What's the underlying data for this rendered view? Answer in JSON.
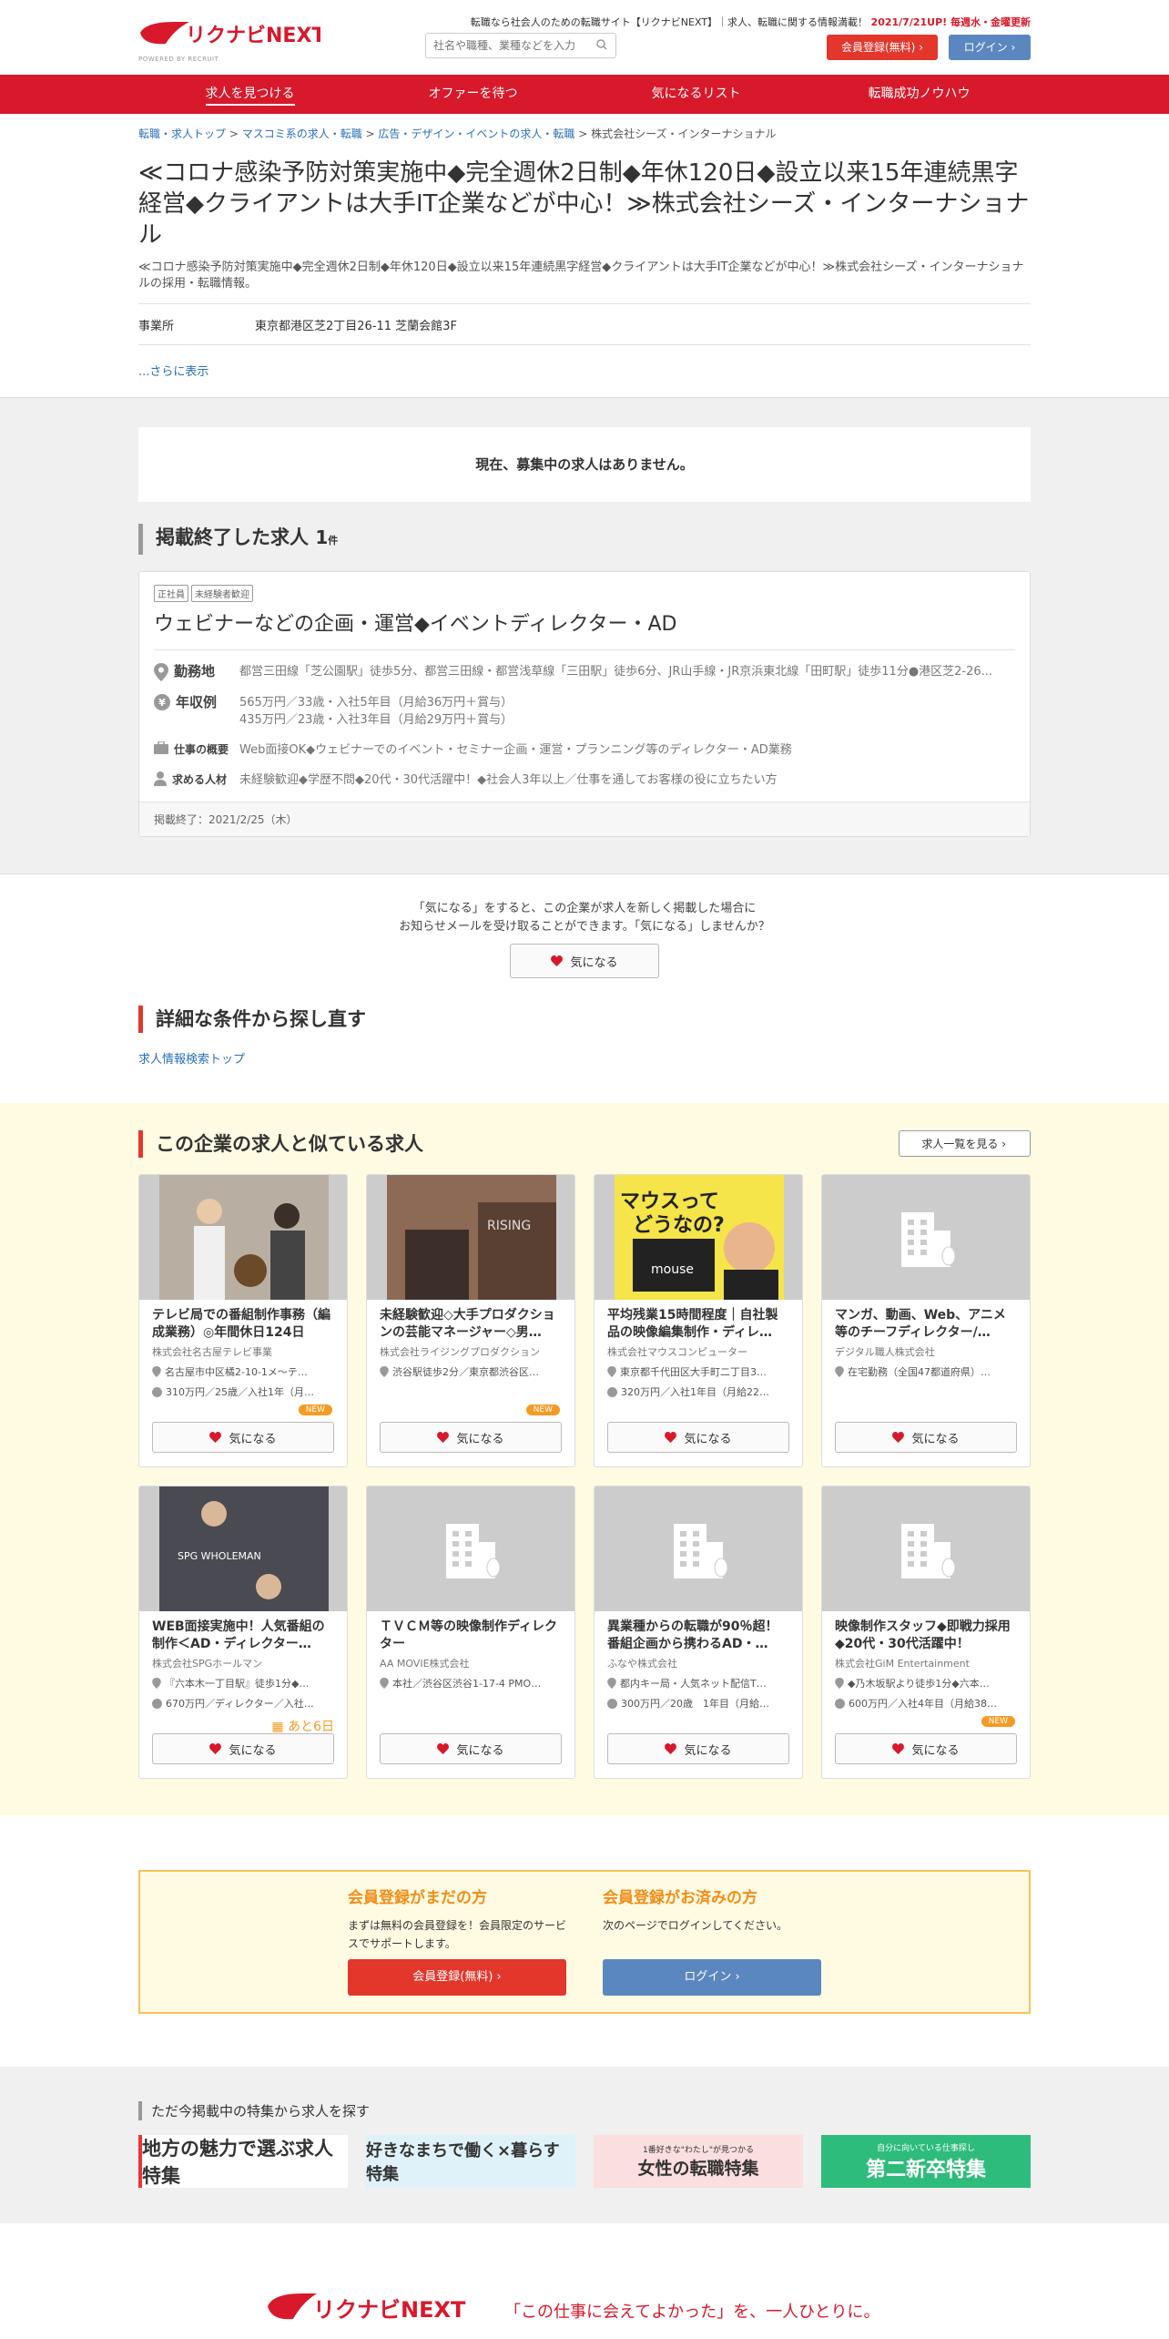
{
  "header": {
    "logo_text": "リクナビNEXT",
    "logo_sub": "POWERED BY RECRUIT",
    "tagline": "転職なら社会人のための転職サイト【リクナビNEXT】｜求人、転職に関する情報満載！",
    "update_notice": "2021/7/21UP! 毎週水・金曜更新",
    "search_placeholder": "社名や職種、業種などを入力",
    "register_label": "会員登録(無料)",
    "login_label": "ログイン"
  },
  "nav": [
    "求人を見つける",
    "オファーを待つ",
    "気になるリスト",
    "転職成功ノウハウ"
  ],
  "breadcrumb": [
    "転職・求人トップ",
    "マスコミ系の求人・転職",
    "広告・デザイン・イベントの求人・転職",
    "株式会社シーズ・インターナショナル"
  ],
  "page": {
    "title": "≪コロナ感染予防対策実施中◆完全週休2日制◆年休120日◆設立以来15年連続黒字経営◆クライアントは大手IT企業などが中心！≫株式会社シーズ・インターナショナル",
    "description": "≪コロナ感染予防対策実施中◆完全週休2日制◆年休120日◆設立以来15年連続黒字経営◆クライアントは大手IT企業などが中心！≫株式会社シーズ・インターナショナルの採用・転職情報。",
    "office_label": "事業所",
    "office_value": "東京都港区芝2丁目26-11 芝蘭会館3F",
    "more_label": "...さらに表示"
  },
  "no_jobs_text": "現在、募集中の求人はありません。",
  "ended": {
    "heading": "掲載終了した求人",
    "count": "1",
    "count_unit": "件",
    "tags": [
      "正社員",
      "未経験者歓迎"
    ],
    "job_title": "ウェビナーなどの企画・運営◆イベントディレクター・AD",
    "location_label": "勤務地",
    "location": "都営三田線「芝公園駅」徒歩5分、都営三田線・都営浅草線「三田駅」徒歩6分、JR山手線・JR京浜東北線「田町駅」徒歩11分●港区芝2-26...",
    "salary_label": "年収例",
    "salary_1": "565万円／33歳・入社5年目（月給36万円＋賞与）",
    "salary_2": "435万円／23歳・入社3年目（月給29万円＋賞与）",
    "overview_label": "仕事の概要",
    "overview": "Web面接OK◆ウェビナーでのイベント・セミナー企画・運営・プランニング等のディレクター・AD業務",
    "seeking_label": "求める人材",
    "seeking": "未経験歓迎◆学歴不問◆20代・30代活躍中！◆社会人3年以上／仕事を通してお客様の役に立ちたい方",
    "end_date": "掲載終了：2021/2/25（木）"
  },
  "fav": {
    "text_1": "「気になる」をすると、この企業が求人を新しく掲載した場合に",
    "text_2": "お知らせメールを受け取ることができます。「気になる」しませんか？",
    "button": "気になる"
  },
  "research": {
    "heading": "詳細な条件から探し直す",
    "link": "求人情報検索トップ"
  },
  "similar": {
    "heading": "この企業の求人と似ている求人",
    "all_button": "求人一覧を見る",
    "fav_label": "気になる",
    "new_label": "NEW",
    "cards": [
      {
        "title": "テレビ局での番組制作事務（編成業務）◎年間休日124日",
        "company": "株式会社名古屋テレビ事業",
        "loc": "名古屋市中区橘2-10-1メ～テ…",
        "sal": "310万円／25歳／入社1年（月…",
        "new": true,
        "photo": "people"
      },
      {
        "title": "未経験歓迎◇大手プロダクションの芸能マネージャー◇男…",
        "company": "株式会社ライジングプロダクション",
        "loc": "渋谷駅徒歩2分／東京都渋谷区…",
        "sal": "",
        "new": true,
        "photo": "building"
      },
      {
        "title": "平均残業15時間程度｜自社製品の映像編集制作・ディレ…",
        "company": "株式会社マウスコンピューター",
        "loc": "東京都千代田区大手町二丁目3…",
        "sal": "320万円／入社1年目（月給22…",
        "new": false,
        "photo": "mouse"
      },
      {
        "title": "マンガ、動画、Web、アニメ等のチーフディレクター/…",
        "company": "デジタル職人株式会社",
        "loc": "在宅勤務（全国47都道府県）…",
        "sal": "",
        "new": false,
        "photo": "none"
      },
      {
        "title": "WEB面接実施中！人気番組の制作＜AD・ディレクター…",
        "company": "株式会社SPGホールマン",
        "loc": "『六本木一丁目駅』徒歩1分◆…",
        "sal": "670万円／ディレクター／入社…",
        "new": false,
        "photo": "spg",
        "days": "あと6日"
      },
      {
        "title": "ＴＶＣＭ等の映像制作ディレクター",
        "company": "AA MOVIE株式会社",
        "loc": "本社／渋谷区渋谷1-17-4 PMO…",
        "sal": "",
        "new": false,
        "photo": "none"
      },
      {
        "title": "異業種からの転職が90％超！番組企画から携わるAD・…",
        "company": "ふなや株式会社",
        "loc": "都内キー局・人気ネット配信T…",
        "sal": "300万円／20歳　1年目（月給…",
        "new": false,
        "photo": "none"
      },
      {
        "title": "映像制作スタッフ◆即戦力採用◆20代・30代活躍中！",
        "company": "株式会社GiM Entertainment",
        "loc": "◆乃木坂駅より徒歩1分◆六本…",
        "sal": "600万円／入社4年目（月給38…",
        "new": true,
        "photo": "none"
      }
    ]
  },
  "member": {
    "not_member_heading": "会員登録がまだの方",
    "not_member_text": "まずは無料の会員登録を！会員限定のサービスでサポートします。",
    "register_button": "会員登録(無料)",
    "member_heading": "会員登録がお済みの方",
    "member_text": "次のページでログインしてください。",
    "login_button": "ログイン"
  },
  "features": {
    "heading": "ただ今掲載中の特集から求人を探す",
    "banners": [
      "地方の魅力で選ぶ求人特集",
      "好きなまちで働く×暮らす特集",
      "女性の転職特集",
      "第二新卒特集"
    ],
    "banner_sub": [
      "",
      "",
      "1番好きな\"わたし\"が見つかる",
      "自分に向いている仕事探し"
    ]
  },
  "footer": {
    "logo_text": "リクナビNEXT",
    "slogan": "「この仕事に会えてよかった」を、一人ひとりに。"
  },
  "colors": {
    "brand_red": "#d7192b",
    "accent_orange": "#f18d18",
    "login_blue": "#5b87c0"
  }
}
